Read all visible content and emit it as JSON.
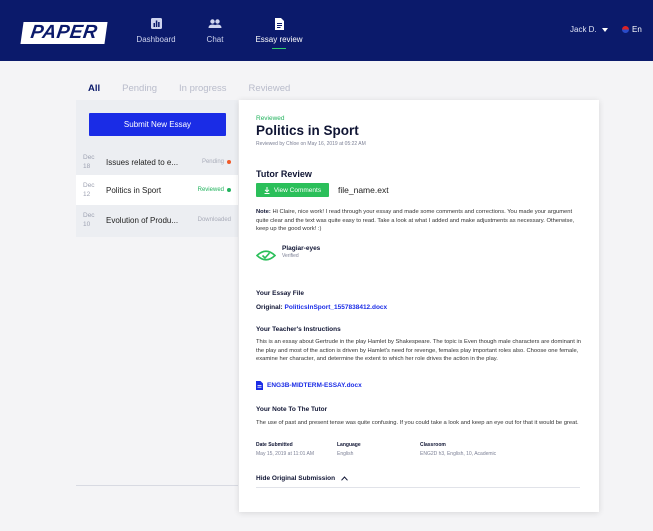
{
  "header": {
    "logo": "PAPER",
    "nav": [
      {
        "label": "Dashboard",
        "icon": "bar-chart-icon"
      },
      {
        "label": "Chat",
        "icon": "people-icon"
      },
      {
        "label": "Essay review",
        "icon": "document-icon",
        "active": true
      }
    ],
    "user": "Jack D.",
    "language": "En"
  },
  "tabs": [
    "All",
    "Pending",
    "In progress",
    "Reviewed"
  ],
  "list": {
    "submit_label": "Submit New Essay",
    "items": [
      {
        "date_month": "Dec",
        "date_day": "18",
        "title": "Issues related to e...",
        "status": "Pending",
        "status_color": "#f05a28"
      },
      {
        "date_month": "Dec",
        "date_day": "12",
        "title": "Politics in Sport",
        "status": "Reviewed",
        "status_color": "#22b35e"
      },
      {
        "date_month": "Dec",
        "date_day": "10",
        "title": "Evolution of Produ...",
        "status": "Downloaded",
        "status_color": ""
      }
    ]
  },
  "detail": {
    "status": "Reviewed",
    "title": "Politics in Sport",
    "reviewed_by": "Reviewed by Chloe on May 16, 2019 at 05:22 AM",
    "tutor_review_heading": "Tutor Review",
    "view_comments": "View Comments",
    "file_name": "file_name.ext",
    "note_label": "Note:",
    "note_text": "Hi Claire, nice work! I read through your essay and made some comments and corrections. You made your argument quite clear and the text was quite easy to read. Take a look at what I added and make adjustments as necessary. Otherwise, keep up the good work! :)",
    "plagiar_title": "Plagiar-eyes",
    "plagiar_status": "Verified",
    "essay_file_heading": "Your Essay File",
    "original_label": "Original:",
    "original_file": "PoliticsInSport_1557838412.docx",
    "instructions_heading": "Your Teacher's Instructions",
    "instructions_text": "This is an essay about Gertrude in the play Hamlet by Shakespeare. The topic is Even though male characters are dominant in the play and most of the action is driven by Hamlet's need for revenge, females play important roles also. Choose one female, examine her character, and determine the extent to which her role drives the action in the play.",
    "instructions_file": "ENG3B-MIDTERM-ESSAY.docx",
    "note_to_tutor_heading": "Your Note To The Tutor",
    "note_to_tutor_text": "The use of past and present tense was quite confusing. If you could take a look and keep an eye out for that it would be great.",
    "meta": {
      "date_label": "Date Submitted",
      "date_value": "May 15, 2019 at 11:01 AM",
      "language_label": "Language",
      "language_value": "English",
      "classroom_label": "Classroom",
      "classroom_value": "ENG2D h3, English, 10, Academic"
    },
    "hide_submission": "Hide Original Submission"
  },
  "colors": {
    "nav_bg": "#0b1a6b",
    "primary": "#1a2ce6",
    "success": "#2bbf5a",
    "pending": "#f05a28"
  }
}
